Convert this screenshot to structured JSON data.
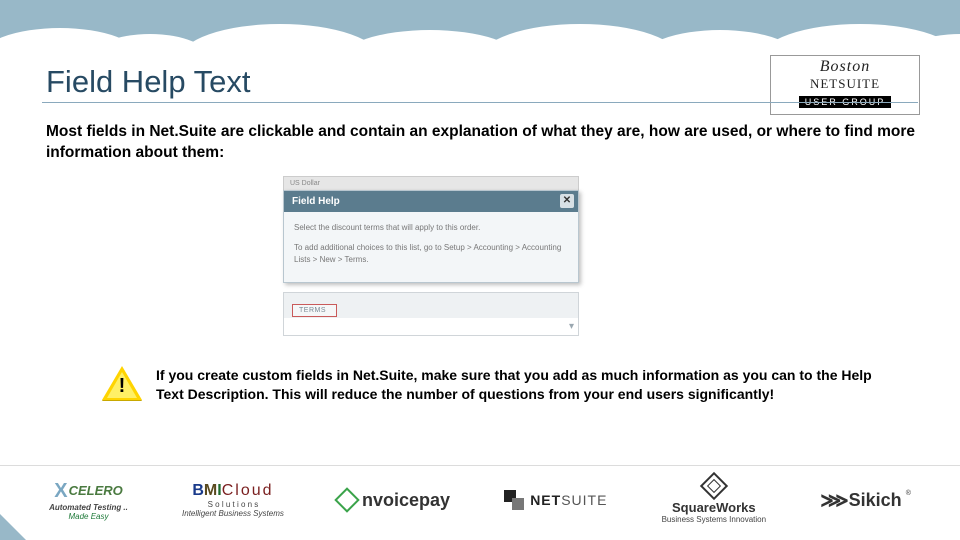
{
  "title": "Field Help Text",
  "intro": "Most fields in Net.Suite are clickable and contain an explanation of what they are, how are used, or where to find more information about them:",
  "popup": {
    "overline": "US Dollar",
    "header": "Field Help",
    "line1": "Select the discount terms that will apply to this order.",
    "line2": "To add additional choices to this list, go to Setup > Accounting > Accounting Lists > New > Terms.",
    "terms_label": "TERMS"
  },
  "tip": "If you create custom fields in Net.Suite, make sure that you add as much information as you can to the Help Text Description. This will reduce the number of questions from your end users significantly!",
  "brand": {
    "line1": "Boston",
    "line2": "NETSUITE",
    "line3": "USER GROUP"
  },
  "sponsors": {
    "xcelero": {
      "name": "CELERO",
      "sub1": "Automated Testing ..",
      "sub2": "Made Easy"
    },
    "bmi": {
      "cloud": "Cloud",
      "sub1": "S o l u t i o n s",
      "sub2": "Intelligent Business Systems"
    },
    "nvoicepay": "nvoicepay",
    "netsuite": {
      "bold": "NET",
      "light": "SUITE"
    },
    "squareworks": {
      "name": "SquareWorks",
      "sub": "Business Systems Innovation"
    },
    "sikich": "Sikich"
  }
}
